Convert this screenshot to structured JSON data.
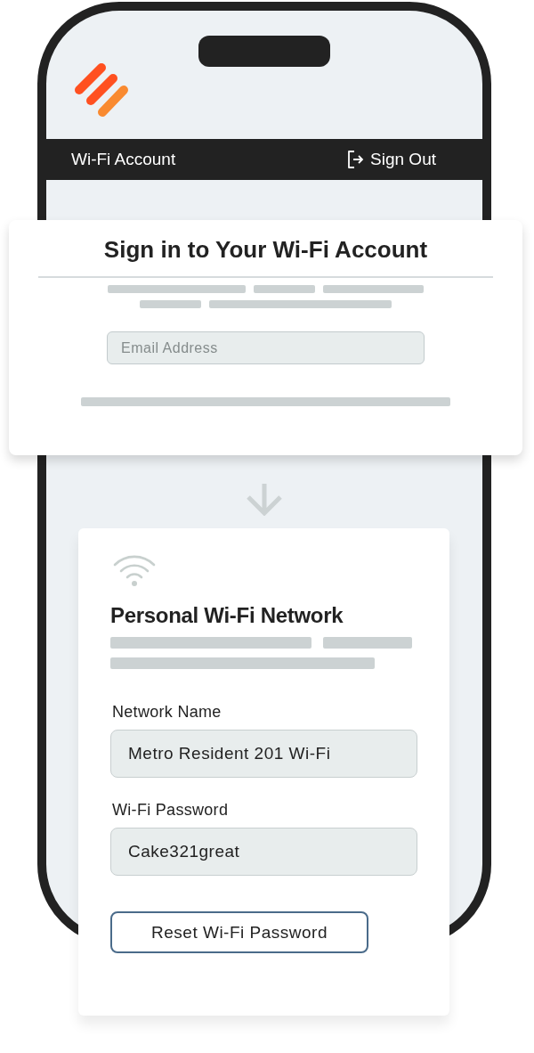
{
  "header": {
    "title": "Wi-Fi Account",
    "sign_out": "Sign Out"
  },
  "sign_in_card": {
    "title": "Sign in to Your Wi-Fi Account",
    "email_field": {
      "placeholder": "Email Address"
    }
  },
  "network_card": {
    "title": "Personal Wi-Fi Network",
    "fields": [
      {
        "label": "Network Name",
        "value": "Metro Resident 201 Wi-Fi"
      },
      {
        "label": "Wi-Fi Password",
        "value": "Cake321great"
      }
    ],
    "reset_button": "Reset Wi-Fi Password"
  }
}
